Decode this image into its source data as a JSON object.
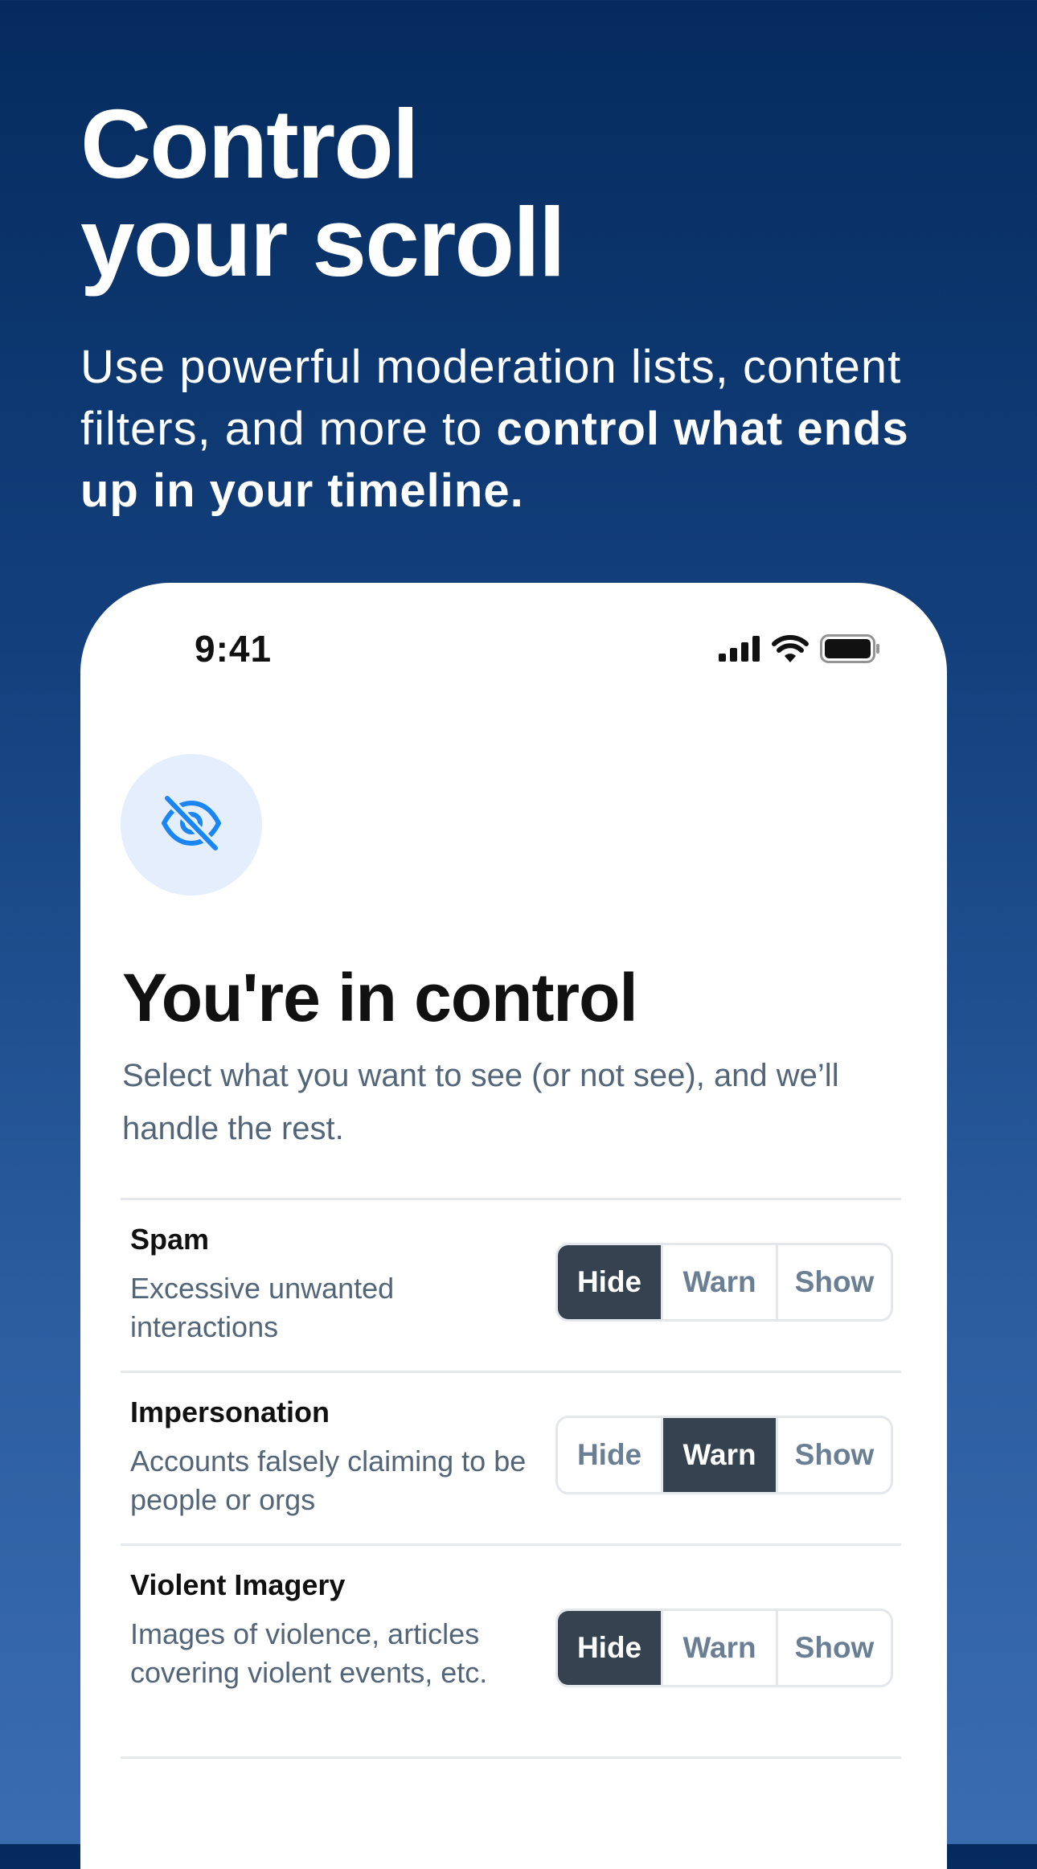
{
  "hero": {
    "title_line1": "Control",
    "title_line2": "your scroll",
    "subtitle_regular": "Use powerful moderation lists, content filters, and more to ",
    "subtitle_bold": "control what ends up in your timeline."
  },
  "status_bar": {
    "time": "9:41",
    "icons": [
      "cellular-signal-icon",
      "wifi-icon",
      "battery-icon"
    ]
  },
  "card": {
    "icon": "eye-slash-icon",
    "title": "You're in control",
    "description": "Select what you want to see (or not see), and we’ll handle the rest."
  },
  "options": [
    "Hide",
    "Warn",
    "Show"
  ],
  "rows": [
    {
      "label": "Spam",
      "description": "Excessive unwanted interactions",
      "selected": "Hide"
    },
    {
      "label": "Impersonation",
      "description": "Accounts falsely claiming to be people or orgs",
      "selected": "Warn"
    },
    {
      "label": "Violent Imagery",
      "description": "Images of violence, articles covering violent events, etc.",
      "selected": "Hide"
    }
  ],
  "colors": {
    "selected_bg": "#354350",
    "accent_blue": "#1a86f5",
    "icon_bg": "#e4eefd"
  }
}
